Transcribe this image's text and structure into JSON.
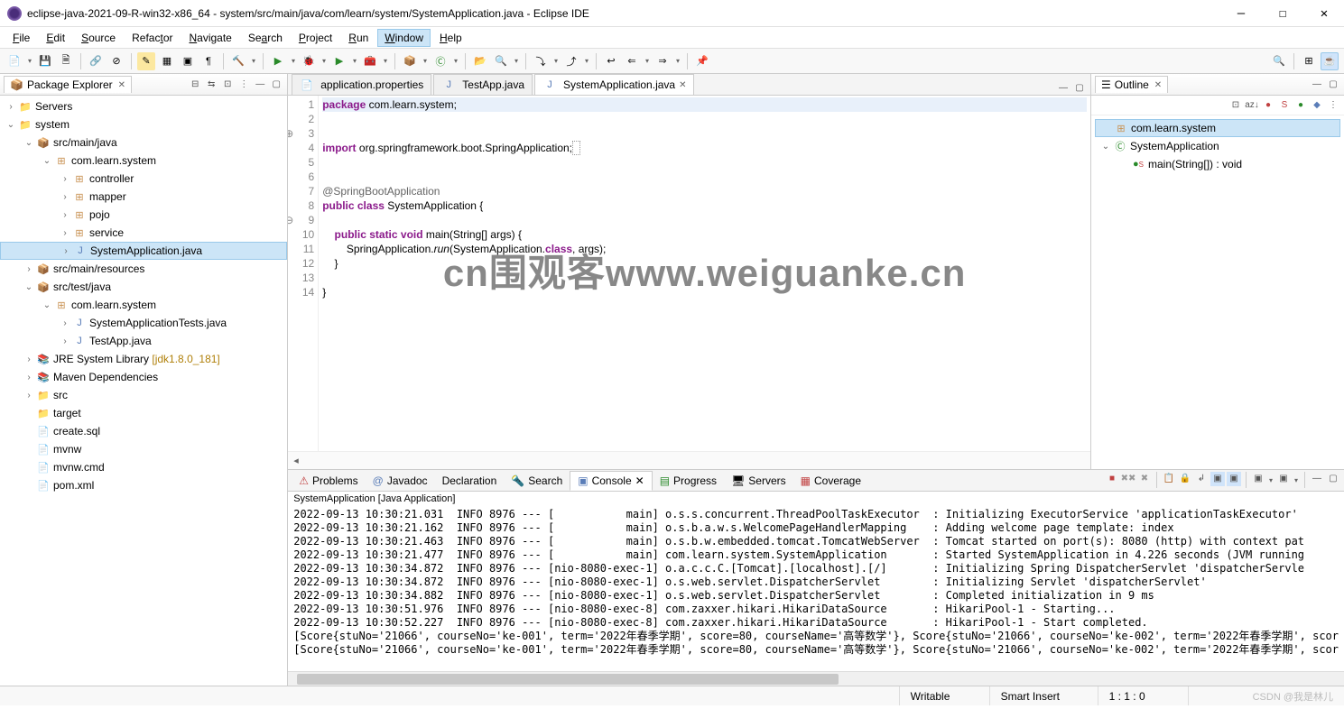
{
  "title": "eclipse-java-2021-09-R-win32-x86_64 - system/src/main/java/com/learn/system/SystemApplication.java - Eclipse IDE",
  "menu": [
    "File",
    "Edit",
    "Source",
    "Refactor",
    "Navigate",
    "Search",
    "Project",
    "Run",
    "Window",
    "Help"
  ],
  "menu_active": "Window",
  "explorer": {
    "title": "Package Explorer",
    "tree": {
      "servers": "Servers",
      "project": "system",
      "smj": "src/main/java",
      "pkg": "com.learn.system",
      "controller": "controller",
      "mapper": "mapper",
      "pojo": "pojo",
      "service": "service",
      "sysapp": "SystemApplication.java",
      "smr": "src/main/resources",
      "stj": "src/test/java",
      "testpkg": "com.learn.system",
      "systests": "SystemApplicationTests.java",
      "testapp": "TestApp.java",
      "jre": "JRE System Library",
      "jre_ver": "[jdk1.8.0_181]",
      "maven": "Maven Dependencies",
      "src": "src",
      "target": "target",
      "createsql": "create.sql",
      "mvnw": "mvnw",
      "mvnwcmd": "mvnw.cmd",
      "pom": "pom.xml"
    }
  },
  "tabs": [
    {
      "label": "application.properties",
      "active": false
    },
    {
      "label": "TestApp.java",
      "active": false
    },
    {
      "label": "SystemApplication.java",
      "active": true
    }
  ],
  "code_lines": [
    "1",
    "2",
    "3",
    "4",
    "5",
    "6",
    "7",
    "8",
    "9",
    "10",
    "11",
    "12",
    "13",
    "14"
  ],
  "code": {
    "l1_a": "package",
    "l1_b": " com.learn.system;",
    "l3_a": "import",
    "l3_b": " org.springframework.boot.SpringApplication;",
    "l6": "@SpringBootApplication",
    "l7_a": "public class",
    "l7_b": " SystemApplication {",
    "l9_a": "    public static void",
    "l9_b": " main(String[] args) {",
    "l10_a": "        SpringApplication.",
    "l10_b": "run",
    "l10_c": "(SystemApplication.",
    "l10_d": "class",
    "l10_e": ", args);",
    "l11": "    }",
    "l13": "}"
  },
  "watermark": "cn围观客www.weiguanke.cn",
  "outline": {
    "title": "Outline",
    "pkg": "com.learn.system",
    "cls": "SystemApplication",
    "mtd": "main(String[]) : void"
  },
  "bottom_tabs": [
    "Problems",
    "Javadoc",
    "Declaration",
    "Search",
    "Console",
    "Progress",
    "Servers",
    "Coverage"
  ],
  "bottom_active": "Console",
  "console_title": "SystemApplication [Java Application]",
  "console_lines": [
    "2022-09-13 10:30:21.031  INFO 8976 --- [           main] o.s.s.concurrent.ThreadPoolTaskExecutor  : Initializing ExecutorService 'applicationTaskExecutor'",
    "2022-09-13 10:30:21.162  INFO 8976 --- [           main] o.s.b.a.w.s.WelcomePageHandlerMapping    : Adding welcome page template: index",
    "2022-09-13 10:30:21.463  INFO 8976 --- [           main] o.s.b.w.embedded.tomcat.TomcatWebServer  : Tomcat started on port(s): 8080 (http) with context pat",
    "2022-09-13 10:30:21.477  INFO 8976 --- [           main] com.learn.system.SystemApplication       : Started SystemApplication in 4.226 seconds (JVM running",
    "2022-09-13 10:30:34.872  INFO 8976 --- [nio-8080-exec-1] o.a.c.c.C.[Tomcat].[localhost].[/]       : Initializing Spring DispatcherServlet 'dispatcherServle",
    "2022-09-13 10:30:34.872  INFO 8976 --- [nio-8080-exec-1] o.s.web.servlet.DispatcherServlet        : Initializing Servlet 'dispatcherServlet'",
    "2022-09-13 10:30:34.882  INFO 8976 --- [nio-8080-exec-1] o.s.web.servlet.DispatcherServlet        : Completed initialization in 9 ms",
    "2022-09-13 10:30:51.976  INFO 8976 --- [nio-8080-exec-8] com.zaxxer.hikari.HikariDataSource       : HikariPool-1 - Starting...",
    "2022-09-13 10:30:52.227  INFO 8976 --- [nio-8080-exec-8] com.zaxxer.hikari.HikariDataSource       : HikariPool-1 - Start completed.",
    "[Score{stuNo='21066', courseNo='ke-001', term='2022年春季学期', score=80, courseName='高等数学'}, Score{stuNo='21066', courseNo='ke-002', term='2022年春季学期', scor",
    "[Score{stuNo='21066', courseNo='ke-001', term='2022年春季学期', score=80, courseName='高等数学'}, Score{stuNo='21066', courseNo='ke-002', term='2022年春季学期', scor"
  ],
  "status": {
    "writable": "Writable",
    "insert": "Smart Insert",
    "pos": "1 : 1 : 0"
  },
  "csdn": "CSDN @我是林儿"
}
